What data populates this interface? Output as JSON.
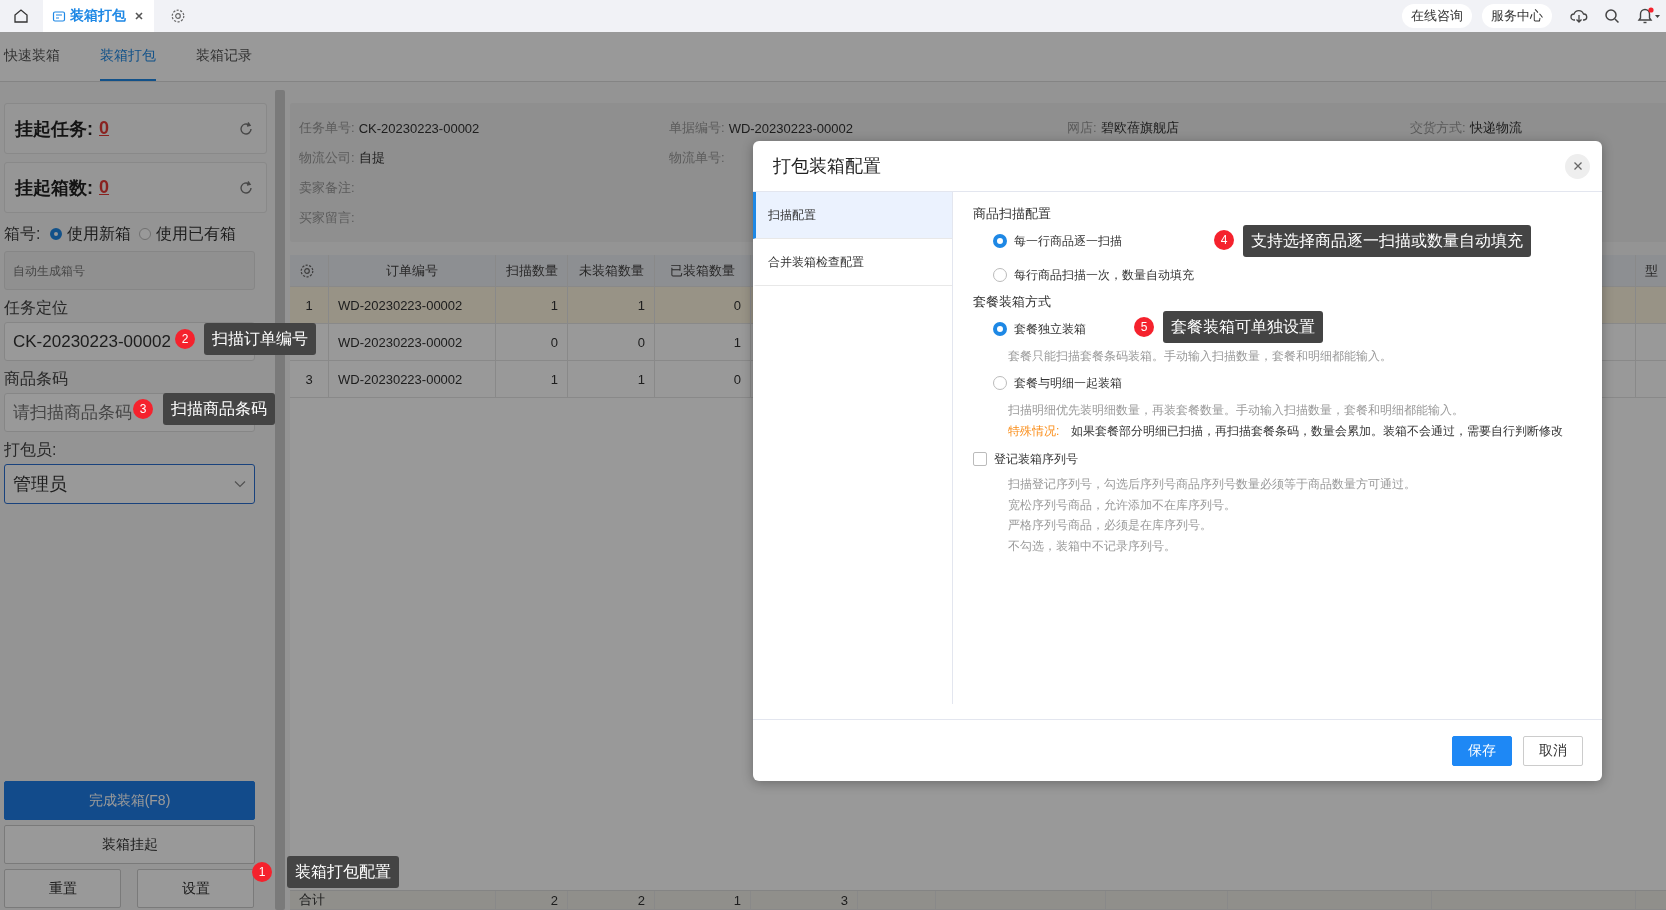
{
  "topbar": {
    "tabs": [
      {
        "label": "装箱打包",
        "selected": true
      }
    ],
    "links": [
      "在线咨询",
      "服务中心"
    ]
  },
  "subtabs": [
    {
      "label": "快速装箱",
      "selected": false
    },
    {
      "label": "装箱打包",
      "selected": true
    },
    {
      "label": "装箱记录",
      "selected": false
    }
  ],
  "left": {
    "counters": [
      {
        "label": "挂起任务:",
        "value": "0"
      },
      {
        "label": "挂起箱数:",
        "value": "0"
      }
    ],
    "box_label": "箱号:",
    "box_options": [
      {
        "label": "使用新箱",
        "selected": true
      },
      {
        "label": "使用已有箱",
        "selected": false
      }
    ],
    "box_placeholder": "自动生成箱号",
    "task_label": "任务定位",
    "task_value": "CK-20230223-00002",
    "barcode_label": "商品条码",
    "barcode_placeholder": "请扫描商品条码",
    "packer_label": "打包员:",
    "packer_value": "管理员",
    "buttons": [
      {
        "label": "完成装箱(F8)",
        "kind": "primary"
      },
      {
        "label": "装箱挂起",
        "kind": "wide"
      },
      {
        "label": "重置",
        "kind": "half"
      },
      {
        "label": "设置",
        "kind": "half"
      }
    ]
  },
  "info": [
    {
      "label": "任务单号:",
      "value": "CK-20230223-00002"
    },
    {
      "label": "单据编号:",
      "value": "WD-20230223-00002"
    },
    {
      "label": "网店:",
      "value": "碧欧蓓旗舰店"
    },
    {
      "label": "交货方式:",
      "value": "快递物流"
    },
    {
      "label": "物流公司:",
      "value": "自提"
    },
    {
      "label": "物流单号:"
    },
    {
      "label": "卖家备注:"
    },
    {
      "label": "买家留言:"
    }
  ],
  "table": {
    "columns": [
      "订单编号",
      "扫描数量",
      "未装箱数量",
      "已装箱数量",
      "型"
    ],
    "rows": [
      {
        "index": "1",
        "order": "WD-20230223-00002",
        "scan": "1",
        "unboxed": "1",
        "boxed": "0",
        "selected": true
      },
      {
        "order": "WD-20230223-00002",
        "scan": "0",
        "unboxed": "0",
        "boxed": "1",
        "selected": false
      },
      {
        "index": "3",
        "order": "WD-20230223-00002",
        "scan": "1",
        "unboxed": "1",
        "boxed": "0",
        "selected": false
      }
    ],
    "footer": {
      "label": "合计",
      "scan": "2",
      "unboxed": "2",
      "boxed": "1",
      "column_6": "3"
    }
  },
  "modal": {
    "title": "打包装箱配置",
    "nav": [
      {
        "label": "扫描配置",
        "selected": true
      },
      {
        "label": "合并装箱检查配置",
        "selected": false
      }
    ],
    "sections": [
      {
        "title": "商品扫描配置",
        "options": [
          {
            "label": "每一行商品逐一扫描",
            "selected": true
          },
          {
            "label": "每行商品扫描一次，数量自动填充",
            "selected": false
          }
        ]
      },
      {
        "title": "套餐装箱方式",
        "options": [
          {
            "label": "套餐独立装箱",
            "selected": true,
            "notes": [
              "套餐只能扫描套餐条码装箱。手动输入扫描数量，套餐和明细都能输入。"
            ]
          },
          {
            "label": "套餐与明细一起装箱",
            "selected": false,
            "notes": [
              "扫描明细优先装明细数量，再装套餐数量。手动输入扫描数量，套餐和明细都能输入。"
            ],
            "warning": {
              "label": "特殊情况:",
              "text": "如果套餐部分明细已扫描，再扫描套餐条码，数量会累加。装箱不会通过，需要自行判断修改"
            }
          }
        ]
      }
    ],
    "checkbox": {
      "label": "登记装箱序列号",
      "checked": false,
      "notes": [
        "扫描登记序列号，勾选后序列号商品序列号数量必须等于商品数量方可通过。",
        "宽松序列号商品，允许添加不在库序列号。",
        "严格序列号商品，必须是在库序列号。",
        "不勾选，装箱中不记录序列号。"
      ]
    },
    "buttons": [
      {
        "label": "保存",
        "kind": "primary"
      },
      {
        "label": "取消",
        "kind": "default"
      }
    ]
  },
  "annotations": [
    {
      "number": "1",
      "text": "装箱打包配置"
    },
    {
      "number": "2",
      "text": "扫描订单编号"
    },
    {
      "number": "3",
      "text": "扫描商品条码"
    },
    {
      "number": "4",
      "text": "支持选择商品逐一扫描或数量自动填充"
    },
    {
      "number": "5",
      "text": "套餐装箱可单独设置"
    }
  ]
}
